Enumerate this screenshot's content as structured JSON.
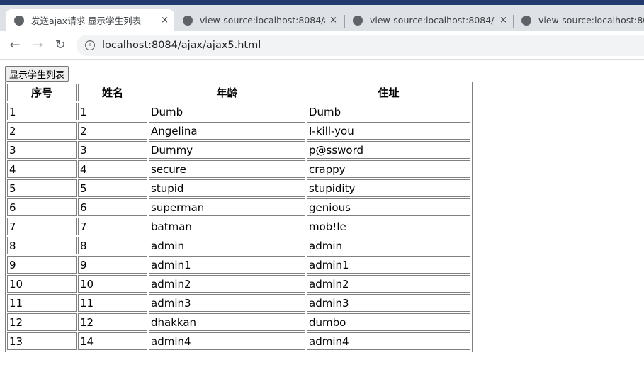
{
  "browser": {
    "tabs": [
      {
        "title": "发送ajax请求 显示学生列表",
        "active": true
      },
      {
        "title": "view-source:localhost:8084/ajax"
      },
      {
        "title": "view-source:localhost:8084/ajax"
      },
      {
        "title": "view-source:localhost:8084/ajax"
      }
    ],
    "close_glyph": "×",
    "url": "localhost:8084/ajax/ajax5.html"
  },
  "page": {
    "button_label": "显示学生列表",
    "headers": [
      "序号",
      "姓名",
      "年龄",
      "住址"
    ],
    "rows": [
      [
        "1",
        "1",
        "Dumb",
        "Dumb"
      ],
      [
        "2",
        "2",
        "Angelina",
        "I-kill-you"
      ],
      [
        "3",
        "3",
        "Dummy",
        "p@ssword"
      ],
      [
        "4",
        "4",
        "secure",
        "crappy"
      ],
      [
        "5",
        "5",
        "stupid",
        "stupidity"
      ],
      [
        "6",
        "6",
        "superman",
        "genious"
      ],
      [
        "7",
        "7",
        "batman",
        "mob!le"
      ],
      [
        "8",
        "8",
        "admin",
        "admin"
      ],
      [
        "9",
        "9",
        "admin1",
        "admin1"
      ],
      [
        "10",
        "10",
        "admin2",
        "admin2"
      ],
      [
        "11",
        "11",
        "admin3",
        "admin3"
      ],
      [
        "12",
        "12",
        "dhakkan",
        "dumbo"
      ],
      [
        "13",
        "14",
        "admin4",
        "admin4"
      ]
    ]
  }
}
